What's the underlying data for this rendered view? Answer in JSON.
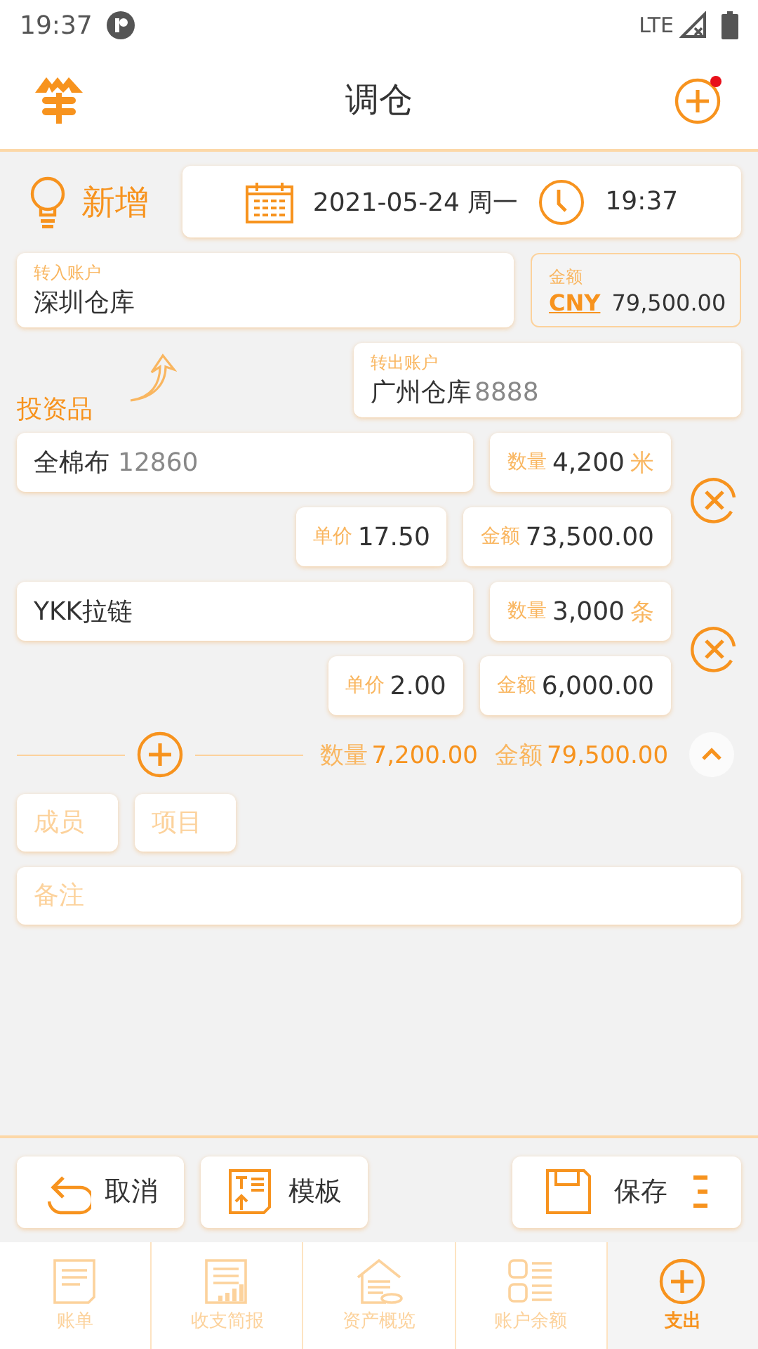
{
  "status_bar": {
    "time": "19:37",
    "network": "LTE"
  },
  "header": {
    "title": "调仓",
    "notification": true
  },
  "mode": {
    "label": "新增"
  },
  "datetime": {
    "date": "2021-05-24 周一",
    "time": "19:37"
  },
  "transfer_in": {
    "label": "转入账户",
    "value": "深圳仓库"
  },
  "amount": {
    "label": "金额",
    "currency": "CNY",
    "value": "79,500.00"
  },
  "transfer_out": {
    "label": "转出账户",
    "value": "广州仓库",
    "code": "8888"
  },
  "section_title": "投资品",
  "items": [
    {
      "name": "全棉布",
      "code": "12860",
      "qty_label": "数量",
      "qty": "4,200",
      "unit": "米",
      "price_label": "单价",
      "price": "17.50",
      "amount_label": "金额",
      "amount": "73,500.00"
    },
    {
      "name": "YKK拉链",
      "qty_label": "数量",
      "qty": "3,000",
      "unit": "条",
      "price_label": "单价",
      "price": "2.00",
      "amount_label": "金额",
      "amount": "6,000.00"
    }
  ],
  "totals": {
    "qty_label": "数量",
    "qty": "7,200.00",
    "amount_label": "金额",
    "amount": "79,500.00",
    "expanded": true
  },
  "tags": [
    {
      "placeholder": "成员"
    },
    {
      "placeholder": "项目"
    }
  ],
  "note": {
    "placeholder": "备注"
  },
  "actions": [
    {
      "label": "取消",
      "kind": "cancel"
    },
    {
      "label": "模板",
      "kind": "template"
    },
    {
      "label": "保存",
      "kind": "save"
    }
  ],
  "tabs": [
    {
      "label": "账单",
      "kind": "bill",
      "selected": false
    },
    {
      "label": "收支简报",
      "kind": "report",
      "selected": false
    },
    {
      "label": "资产概览",
      "kind": "assets",
      "selected": false
    },
    {
      "label": "账户余额",
      "kind": "balance",
      "selected": false
    },
    {
      "label": "支出",
      "kind": "add",
      "selected": true
    }
  ]
}
